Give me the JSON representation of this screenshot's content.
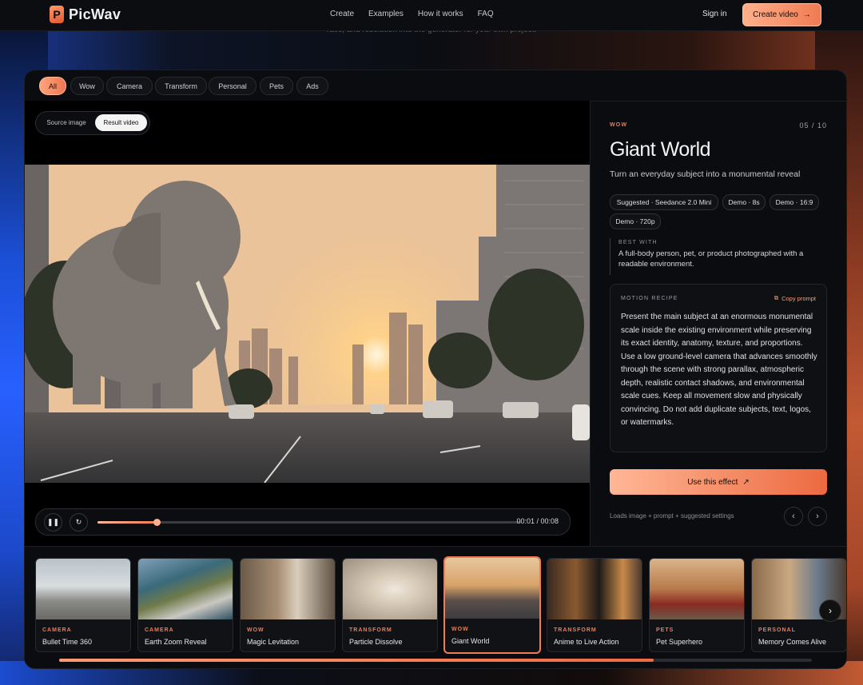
{
  "nav": {
    "logo_letter": "P",
    "logo_text": "PicWav",
    "links": [
      "Create",
      "Examples",
      "How it works",
      "FAQ"
    ],
    "signin": "Sign in",
    "create_video": "Create video",
    "create_video_icon": "arrow-right-icon"
  },
  "hint": "ratio, and resolution into the generator for your own project.",
  "filters": [
    "All",
    "Wow",
    "Camera",
    "Transform",
    "Personal",
    "Pets",
    "Ads"
  ],
  "active_filter": "All",
  "media": {
    "toggle": {
      "source": "Source image",
      "result": "Result video",
      "active": "Result video"
    },
    "player": {
      "time": "00:01 / 00:08",
      "progress": 0.14,
      "pause_icon": "pause-icon",
      "replay_icon": "replay-icon"
    }
  },
  "detail": {
    "category": "WOW",
    "counter": "05 / 10",
    "title": "Giant World",
    "subtitle": "Turn an everyday subject into a monumental reveal",
    "pills": [
      "Suggested · Seedance 2.0 Mini",
      "Demo · 8s",
      "Demo · 16:9",
      "Demo · 720p"
    ],
    "best_with_label": "BEST WITH",
    "best_with": "A full-body person, pet, or product photographed with a readable environment.",
    "recipe_label": "MOTION RECIPE",
    "copy_prompt": "Copy prompt",
    "recipe": "Present the main subject at an enormous monumental scale inside the existing environment while preserving its exact identity, anatomy, texture, and proportions. Use a low ground-level camera that advances smoothly through the scene with strong parallax, atmospheric depth, realistic contact shadows, and environmental scale cues. Keep all movement slow and physically convincing. Do not add duplicate subjects, text, logos, or watermarks.",
    "use_effect": "Use this effect",
    "use_effect_icon": "arrow-up-right-icon",
    "loads": "Loads image + prompt + suggested settings",
    "prev_icon": "chevron-left-icon",
    "next_icon": "chevron-right-icon"
  },
  "thumbnails": [
    {
      "category": "CAMERA",
      "name": "Bullet Time 360"
    },
    {
      "category": "CAMERA",
      "name": "Earth Zoom Reveal"
    },
    {
      "category": "WOW",
      "name": "Magic Levitation"
    },
    {
      "category": "TRANSFORM",
      "name": "Particle Dissolve"
    },
    {
      "category": "WOW",
      "name": "Giant World"
    },
    {
      "category": "TRANSFORM",
      "name": "Anime to Live Action"
    },
    {
      "category": "PETS",
      "name": "Pet Superhero"
    },
    {
      "category": "PERSONAL",
      "name": "Memory Comes Alive"
    }
  ],
  "strip_scroll": 0.79,
  "colors": {
    "accent": "#f07c55",
    "accent_light": "#ffb08c",
    "background": "#07090d"
  }
}
